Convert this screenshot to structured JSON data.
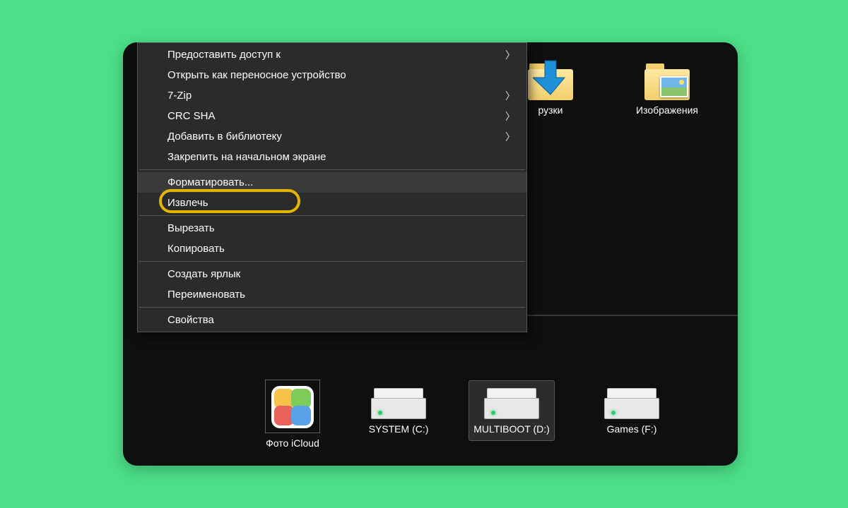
{
  "contextMenu": {
    "items": [
      {
        "label": "Предоставить доступ к",
        "submenu": true
      },
      {
        "label": "Открыть как переносное устройство",
        "submenu": false
      },
      {
        "label": "7-Zip",
        "submenu": true
      },
      {
        "label": "CRC SHA",
        "submenu": true
      },
      {
        "label": "Добавить в библиотеку",
        "submenu": true
      },
      {
        "label": "Закрепить на начальном экране",
        "submenu": false
      }
    ],
    "group2": [
      {
        "label": "Форматировать...",
        "highlighted": true
      },
      {
        "label": "Извлечь"
      }
    ],
    "group3": [
      {
        "label": "Вырезать"
      },
      {
        "label": "Копировать"
      }
    ],
    "group4": [
      {
        "label": "Создать ярлык"
      },
      {
        "label": "Переименовать"
      }
    ],
    "group5": [
      {
        "label": "Свойства"
      }
    ]
  },
  "desktop": {
    "downloads_label": "рузки",
    "pictures_label": "Изображения",
    "photos_label": "Фото iCloud",
    "drives": [
      {
        "label": "SYSTEM (C:)"
      },
      {
        "label": "MULTIBOOT (D:)",
        "selected": true
      },
      {
        "label": "Games (F:)"
      }
    ]
  },
  "colors": {
    "page_bg": "#4de089",
    "menu_bg": "#2b2b2b",
    "highlight_ring": "#e5b400"
  }
}
